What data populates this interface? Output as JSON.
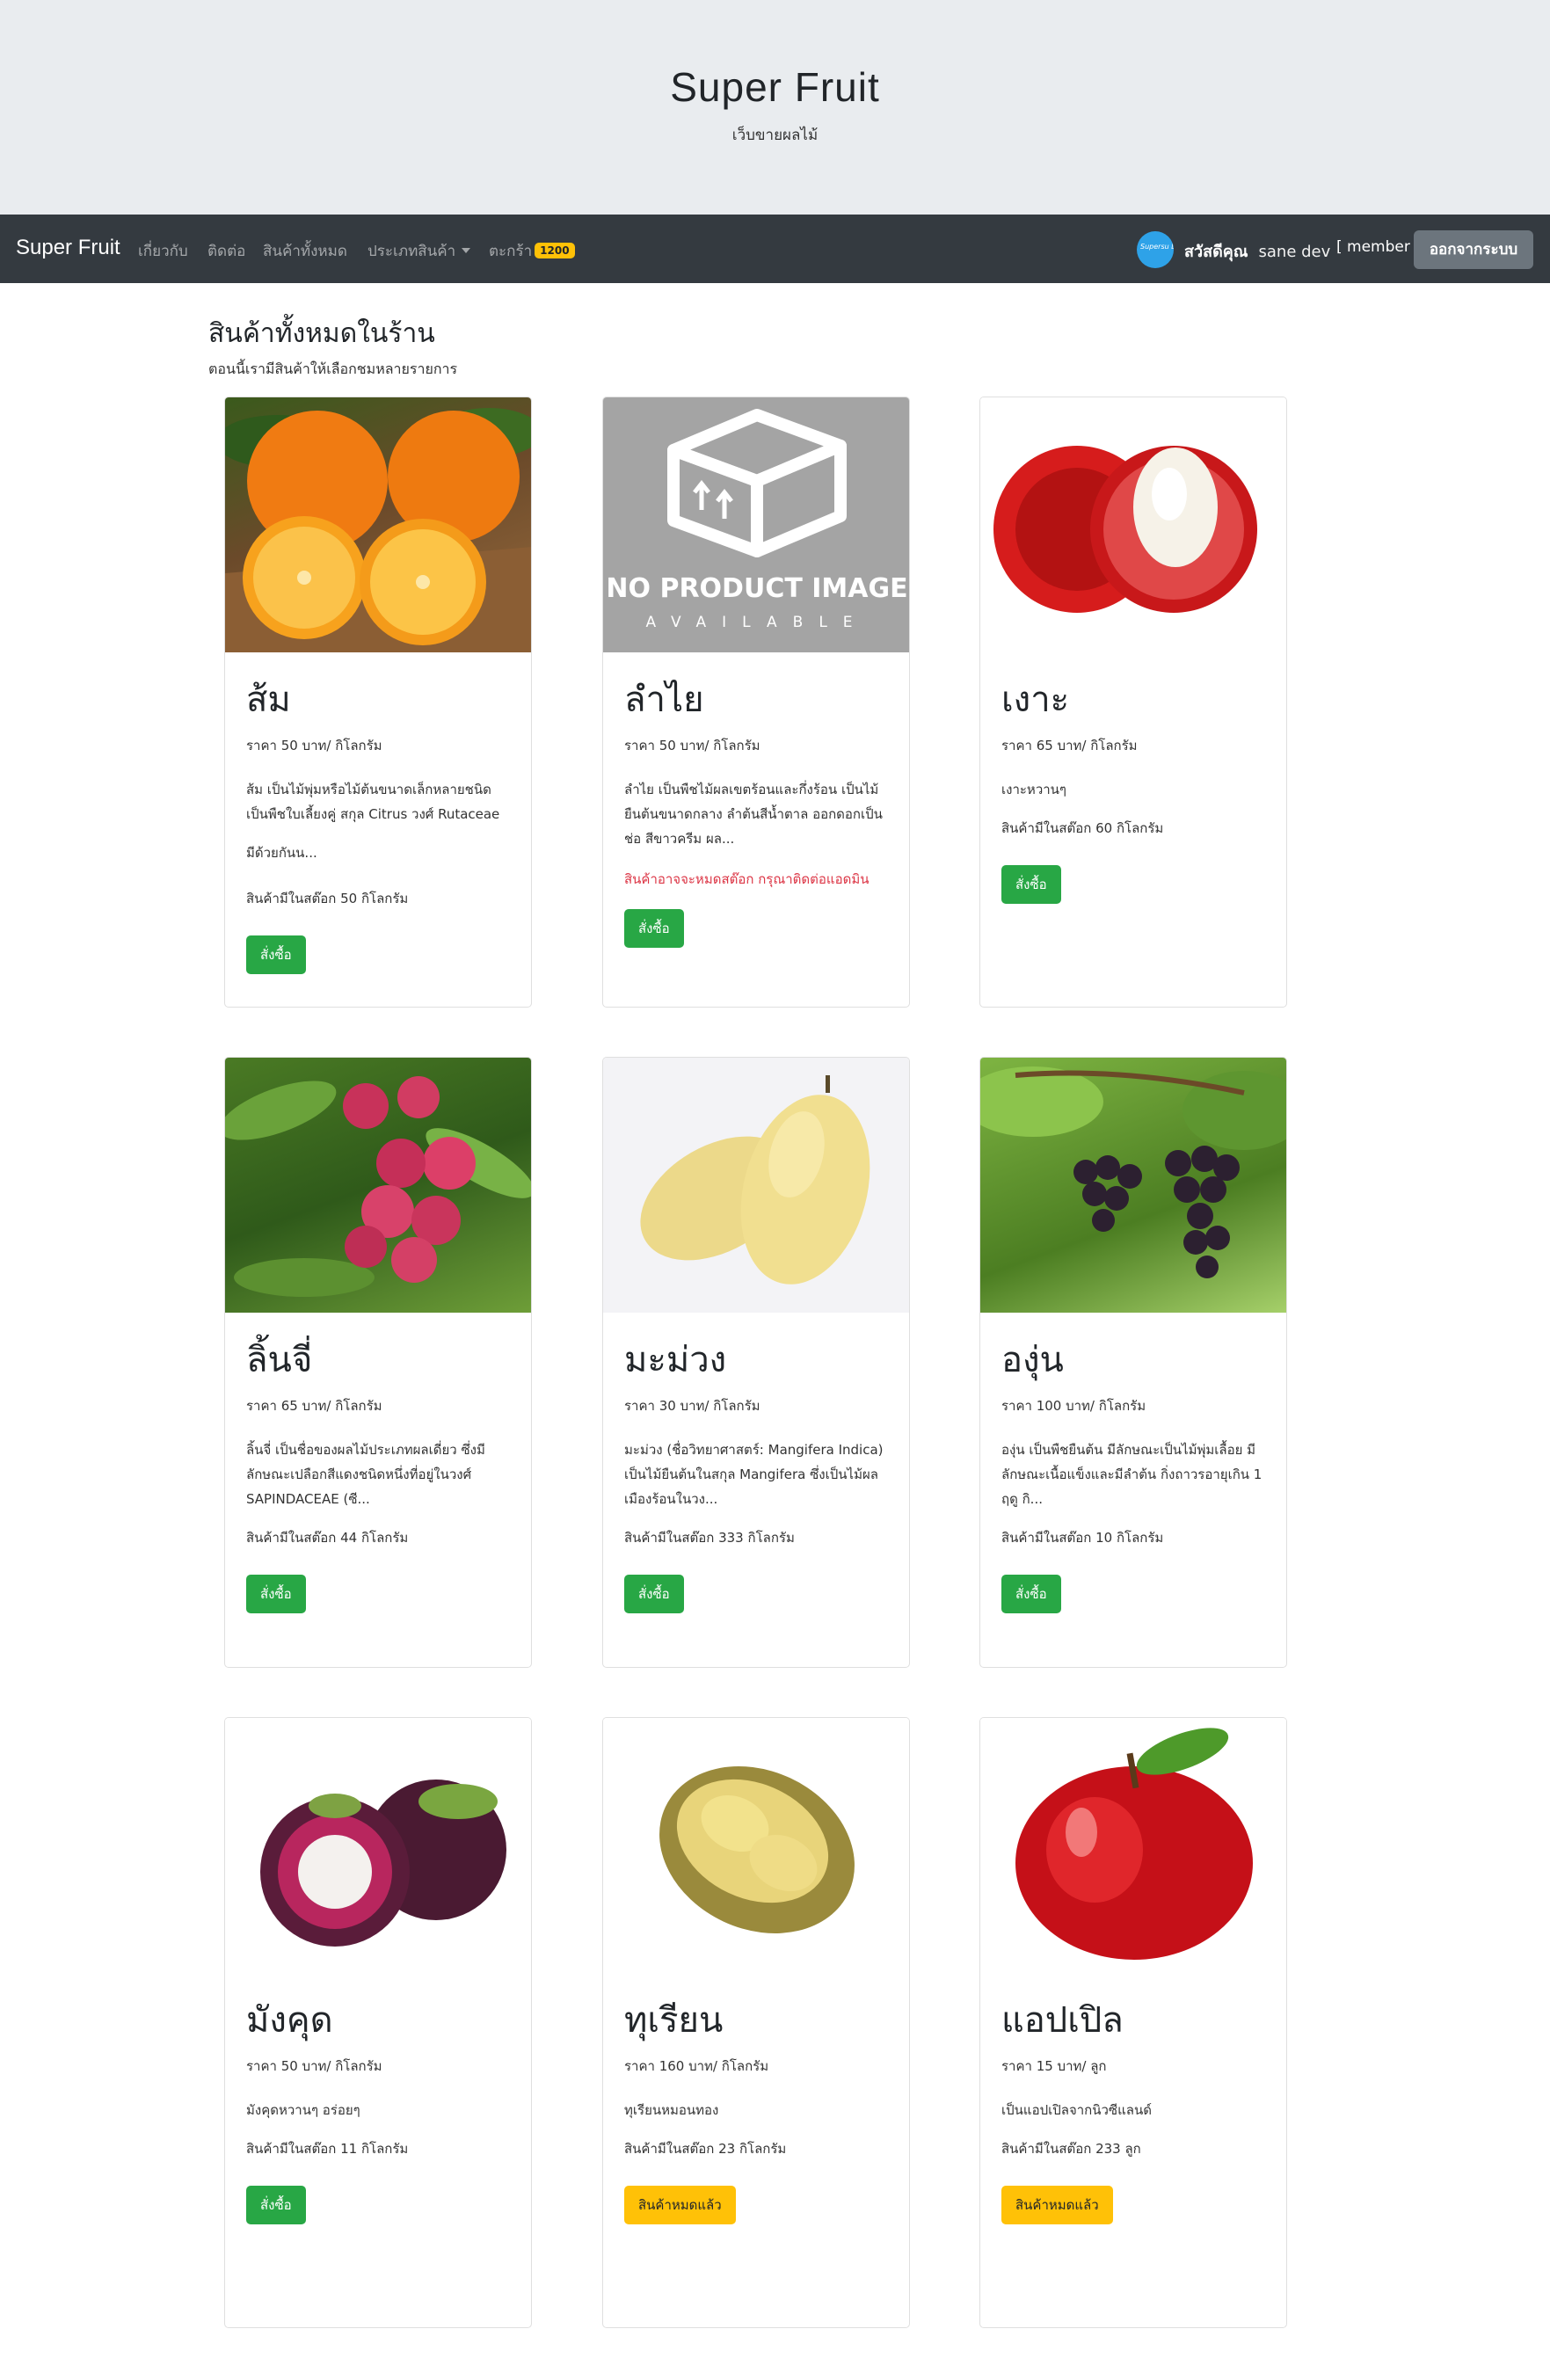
{
  "header": {
    "title": "Super Fruit",
    "subtitle": "เว็บขายผลไม้"
  },
  "navbar": {
    "brand": "Super Fruit",
    "links": [
      "เกี่ยวกับ",
      "ติดต่อ",
      "สินค้าทั้งหมด",
      "ประเภทสินค้า",
      "ตะกร้า"
    ],
    "cart_count": "1200",
    "avatar_text": "Supersu Dev",
    "greeting": "สวัสดีคุณ",
    "user_name": "sane dev",
    "role": "[ member ]",
    "logout": "ออกจากระบบ"
  },
  "section": {
    "title": "สินค้าทั้งหมดในร้าน",
    "subtitle": "ตอนนี้เรามีสินค้าให้เลือกชมหลายรายการ"
  },
  "products": [
    {
      "name": "ส้ม",
      "price": "ราคา 50 บาท/ กิโลกรัม",
      "desc": "ส้ม เป็นไม้พุ่มหรือไม้ต้นขนาดเล็กหลายชนิด เป็นพืชใบเลี้ยงคู่ สกุล Citrus วงศ์ Rutaceae",
      "extra": "มีด้วยกันน...",
      "stock": "สินค้ามีในสต๊อก 50 กิโลกรัม",
      "button": "สั่งซื้อ",
      "image": "orange"
    },
    {
      "name": "ลำไย",
      "price": "ราคา 50 บาท/ กิโลกรัม",
      "desc": "ลำไย เป็นพืชไม้ผลเขตร้อนและกึ่งร้อน เป็นไม้ยืนต้นขนาดกลาง ลำต้นสีน้ำตาล ออกดอกเป็นช่อ สีขาวครีม ผล...",
      "warning": "สินค้าอาจจะหมดสต๊อก กรุณาติดต่อแอดมิน",
      "button": "สั่งซื้อ",
      "image": "no-image",
      "no_image_title": "NO PRODUCT IMAGE",
      "no_image_sub": "AVAILABLE"
    },
    {
      "name": "เงาะ",
      "price": "ราคา 65 บาท/ กิโลกรัม",
      "desc": "เงาะหวานๆ",
      "stock": "สินค้ามีในสต๊อก 60 กิโลกรัม",
      "button": "สั่งซื้อ",
      "image": "rambutan"
    },
    {
      "name": "ลิ้นจี่",
      "price": "ราคา 65 บาท/ กิโลกรัม",
      "desc": "ลิ้นจี่ เป็นชื่อของผลไม้ประเภทผลเดี่ยว ซึ่งมีลักษณะเปลือกสีแดงชนิดหนึ่งที่อยู่ในวงศ์ SAPINDACEAE (ซี...",
      "stock": "สินค้ามีในสต๊อก 44 กิโลกรัม",
      "button": "สั่งซื้อ",
      "image": "lychee"
    },
    {
      "name": "มะม่วง",
      "price": "ราคา 30 บาท/ กิโลกรัม",
      "desc": "มะม่วง (ชื่อวิทยาศาสตร์: Mangifera Indica) เป็นไม้ยืนต้นในสกุล Mangifera ซึ่งเป็นไม้ผลเมืองร้อนในวง...",
      "stock": "สินค้ามีในสต๊อก 333 กิโลกรัม",
      "button": "สั่งซื้อ",
      "image": "mango"
    },
    {
      "name": "องุ่น",
      "price": "ราคา 100 บาท/ กิโลกรัม",
      "desc": "องุ่น เป็นพืชยืนต้น มีลักษณะเป็นไม้พุ่มเลื้อย มีลักษณะเนื้อแข็งและมีลำต้น กิ่งถาวรอายุเกิน 1 ฤดู กิ...",
      "stock": "สินค้ามีในสต๊อก 10 กิโลกรัม",
      "button": "สั่งซื้อ",
      "image": "grape"
    },
    {
      "name": "มังคุด",
      "price": "ราคา 50 บาท/ กิโลกรัม",
      "desc": "มังคุดหวานๆ อร่อยๆ",
      "stock": "สินค้ามีในสต๊อก 11 กิโลกรัม",
      "button": "สั่งซื้อ",
      "image": "mangosteen"
    },
    {
      "name": "ทุเรียน",
      "price": "ราคา 160 บาท/ กิโลกรัม",
      "desc": "ทุเรียนหมอนทอง",
      "stock": "สินค้ามีในสต๊อก 23 กิโลกรัม",
      "button": "สินค้าหมดแล้ว",
      "image": "durian"
    },
    {
      "name": "แอปเปิล",
      "price": "ราคา 15 บาท/ ลูก",
      "desc": "เป็นแอปเปิลจากนิวซีแลนด์",
      "stock": "สินค้ามีในสต๊อก 233 ลูก",
      "button": "สินค้าหมดแล้ว",
      "image": "apple"
    }
  ],
  "colors": {
    "success": "#28a745",
    "warning": "#ffc107",
    "danger": "#dc3545",
    "navbar": "#343a40",
    "jumbotron": "#e9ecef"
  }
}
